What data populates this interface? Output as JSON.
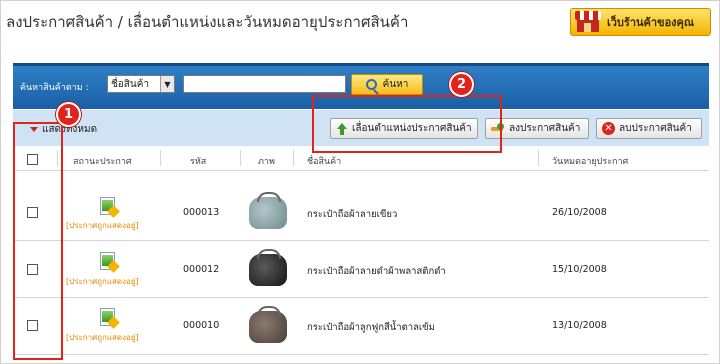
{
  "page_title": "ลงประกาศสินค้า / เลื่อนตำแหน่งและวันหมดอายุประกาศสินค้า",
  "shop_button_label": "เว็บร้านค้าของคุณ",
  "search": {
    "label": "ค้นหาสินค้าตาม :",
    "field_selected": "ชื่อสินค้า",
    "input_value": "",
    "button_label": "ค้นหา"
  },
  "toolbar": {
    "show_all_label": "แสดงทั้งหมด",
    "promote_label": "เลื่อนตำแหน่งประกาศสินค้า",
    "add_label": "ลงประกาศสินค้า",
    "delete_label": "ลบประกาศสินค้า"
  },
  "table": {
    "headers": {
      "status": "สถานะประกาศ",
      "code": "รหัส",
      "image": "ภาพ",
      "name": "ชื่อสินค้า",
      "expiry": "วันหมดอายุประกาศ"
    },
    "rows": [
      {
        "status": "[ประกาศถูกแสดงอยู่]",
        "code": "000013",
        "name": "กระเป๋าถือผ้าลายเขียว",
        "expiry": "26/10/2008",
        "image_icon": "bag-green-image"
      },
      {
        "status": "[ประกาศถูกแสดงอยู่]",
        "code": "000012",
        "name": "กระเป๋าถือผ้าลายดำผ้าพลาสติกดำ",
        "expiry": "15/10/2008",
        "image_icon": "bag-black-image"
      },
      {
        "status": "[ประกาศถูกแสดงอยู่]",
        "code": "000010",
        "name": "กระเป๋าถือผ้าลูกฟูกสีน้ำตาลเข้ม",
        "expiry": "13/10/2008",
        "image_icon": "bag-brown-image"
      }
    ]
  },
  "callouts": {
    "one": "1",
    "two": "2"
  },
  "colors": {
    "search_bar": "#1b5fa6",
    "toolbar_bg": "#cfe3f5",
    "callout_red": "#e0241b",
    "status_orange": "#e08a00"
  }
}
